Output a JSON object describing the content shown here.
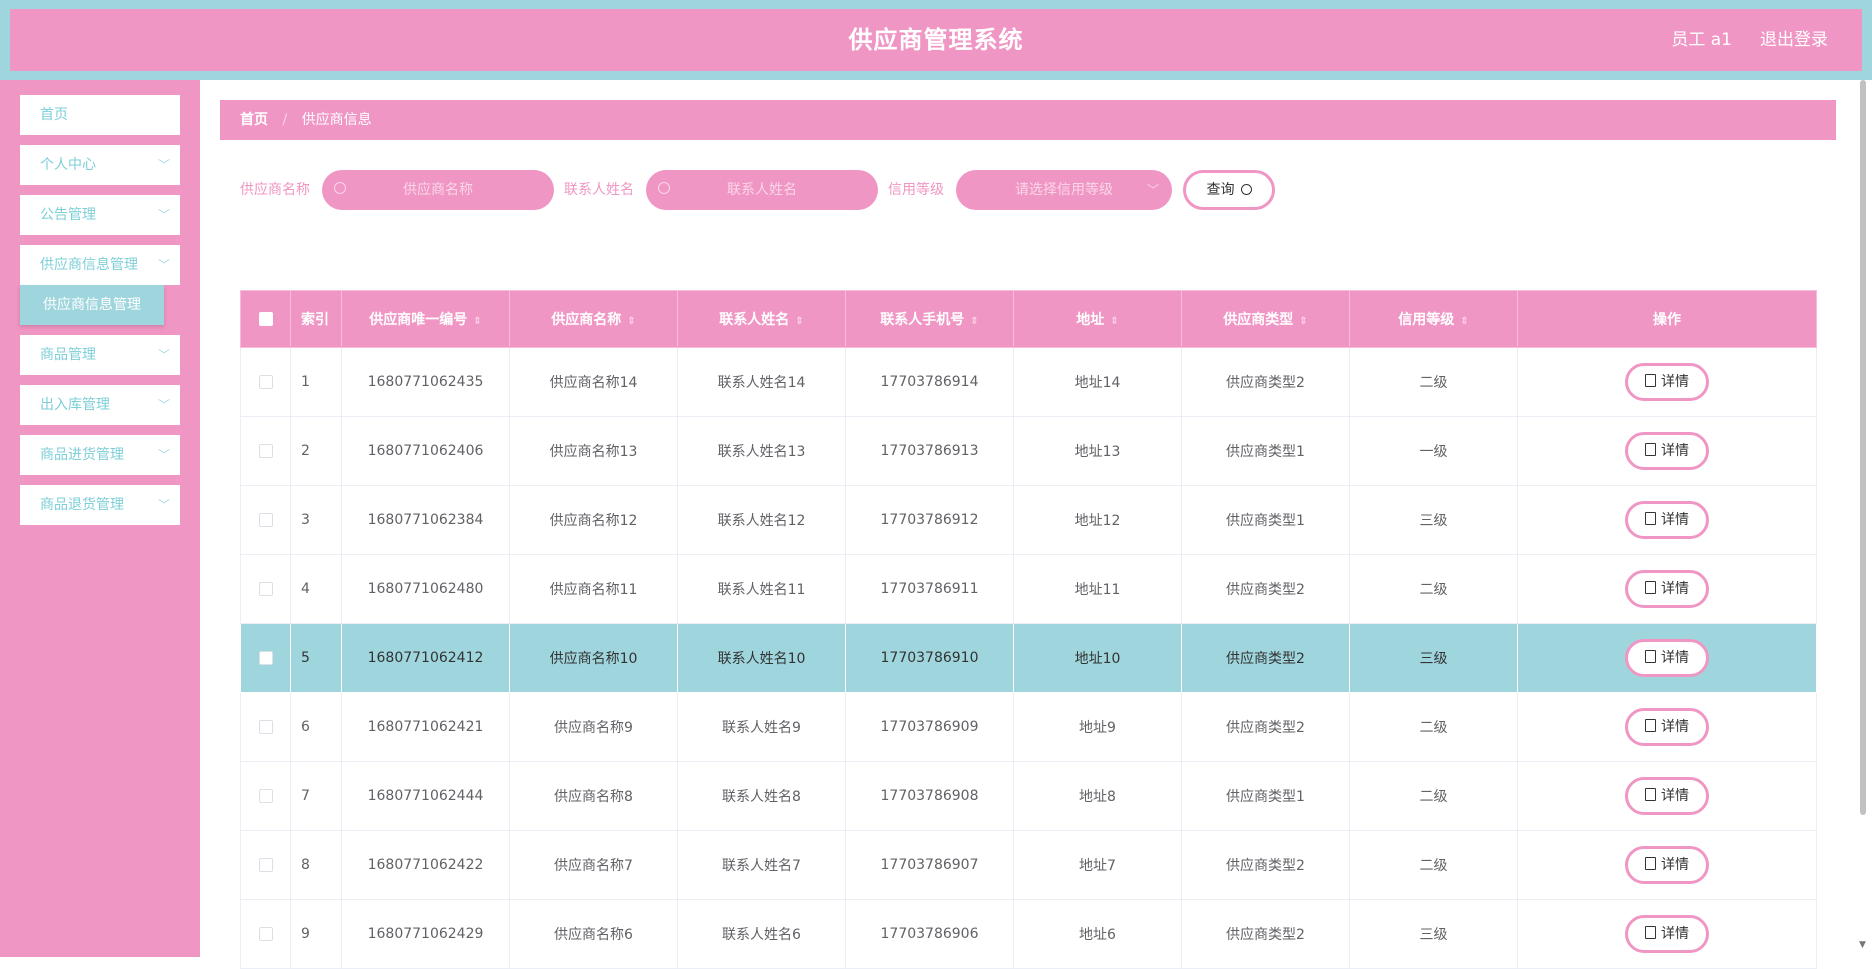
{
  "header": {
    "title": "供应商管理系统",
    "user": "员工 a1",
    "logout": "退出登录"
  },
  "sidebar": {
    "items": [
      {
        "label": "首页"
      },
      {
        "label": "个人中心"
      },
      {
        "label": "公告管理"
      },
      {
        "label": "供应商信息管理"
      },
      {
        "label": "商品管理"
      },
      {
        "label": "出入库管理"
      },
      {
        "label": "商品进货管理"
      },
      {
        "label": "商品退货管理"
      }
    ],
    "submenu": {
      "label": "供应商信息管理"
    }
  },
  "breadcrumb": {
    "home": "首页",
    "sep": "/",
    "current": "供应商信息"
  },
  "filters": {
    "supplier_name_label": "供应商名称",
    "supplier_name_placeholder": "供应商名称",
    "contact_name_label": "联系人姓名",
    "contact_name_placeholder": "联系人姓名",
    "credit_label": "信用等级",
    "credit_placeholder": "请选择信用等级",
    "query_label": "查询"
  },
  "table": {
    "columns": [
      "索引",
      "供应商唯一编号",
      "供应商名称",
      "联系人姓名",
      "联系人手机号",
      "地址",
      "供应商类型",
      "信用等级",
      "操作"
    ],
    "detail_label": "详情",
    "rows": [
      [
        "1",
        "1680771062435",
        "供应商名称14",
        "联系人姓名14",
        "17703786914",
        "地址14",
        "供应商类型2",
        "二级"
      ],
      [
        "2",
        "1680771062406",
        "供应商名称13",
        "联系人姓名13",
        "17703786913",
        "地址13",
        "供应商类型1",
        "一级"
      ],
      [
        "3",
        "1680771062384",
        "供应商名称12",
        "联系人姓名12",
        "17703786912",
        "地址12",
        "供应商类型1",
        "三级"
      ],
      [
        "4",
        "1680771062480",
        "供应商名称11",
        "联系人姓名11",
        "17703786911",
        "地址11",
        "供应商类型2",
        "二级"
      ],
      [
        "5",
        "1680771062412",
        "供应商名称10",
        "联系人姓名10",
        "17703786910",
        "地址10",
        "供应商类型2",
        "三级"
      ],
      [
        "6",
        "1680771062421",
        "供应商名称9",
        "联系人姓名9",
        "17703786909",
        "地址9",
        "供应商类型2",
        "二级"
      ],
      [
        "7",
        "1680771062444",
        "供应商名称8",
        "联系人姓名8",
        "17703786908",
        "地址8",
        "供应商类型1",
        "二级"
      ],
      [
        "8",
        "1680771062422",
        "供应商名称7",
        "联系人姓名7",
        "17703786907",
        "地址7",
        "供应商类型2",
        "二级"
      ],
      [
        "9",
        "1680771062429",
        "供应商名称6",
        "联系人姓名6",
        "17703786906",
        "地址6",
        "供应商类型2",
        "三级"
      ]
    ]
  },
  "colors": {
    "pink": "#f096c4",
    "teal": "#9fd6dd"
  }
}
